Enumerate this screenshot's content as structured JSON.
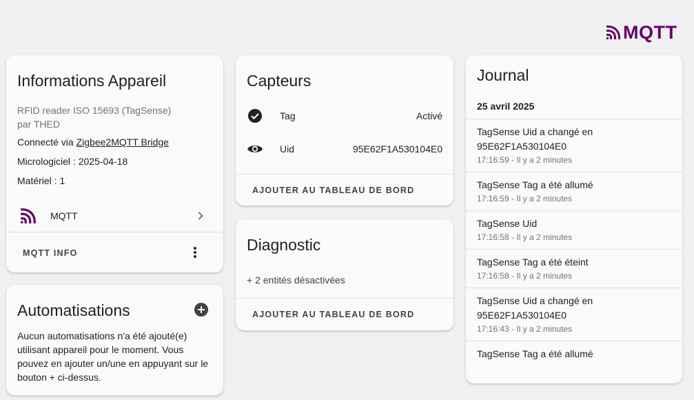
{
  "brand": {
    "logo_text": "MQTT",
    "color": "#660066"
  },
  "device": {
    "title": "Informations Appareil",
    "model": "RFID reader ISO 15693 (TagSense)",
    "by": "par THED",
    "connected_prefix": "Connecté via ",
    "connected_link": "Zigbee2MQTT Bridge",
    "firmware": "Micrologiciel : 2025-04-18",
    "hardware": "Matériel : 1",
    "integration_label": "MQTT",
    "integration_icon": "mqtt-icon",
    "action_label": "MQTT INFO"
  },
  "automations": {
    "title": "Automatisations",
    "empty_text": "Aucun automatisations n'a été ajouté(e) utilisant appareil pour le moment. Vous pouvez en ajouter un/une en appuyant sur le bouton + ci-dessus."
  },
  "sensors": {
    "title": "Capteurs",
    "entities": [
      {
        "icon": "check-circle-icon",
        "name": "Tag",
        "state": "Activé"
      },
      {
        "icon": "eye-icon",
        "name": "Uid",
        "state": "95E62F1A530104E0"
      }
    ],
    "action_label": "AJOUTER AU TABLEAU DE BORD"
  },
  "diagnostic": {
    "title": "Diagnostic",
    "hidden_text": "+ 2 entités désactivées",
    "action_label": "AJOUTER AU TABLEAU DE BORD"
  },
  "journal": {
    "title": "Journal",
    "date": "25 avril 2025",
    "entries": [
      {
        "message": "TagSense Uid a changé en 95E62F1A530104E0",
        "time": "17:16:59 - Il y a 2 minutes"
      },
      {
        "message": "TagSense Tag a été allumé",
        "time": "17:16:59 - Il y a 2 minutes"
      },
      {
        "message": "TagSense Uid",
        "time": "17:16:58 - Il y a 2 minutes"
      },
      {
        "message": "TagSense Tag a été éteint",
        "time": "17:16:58 - Il y a 2 minutes"
      },
      {
        "message": "TagSense Uid a changé en 95E62F1A530104E0",
        "time": "17:16:43 - Il y a 2 minutes"
      },
      {
        "message": "TagSense Tag a été allumé",
        "time": ""
      }
    ]
  }
}
